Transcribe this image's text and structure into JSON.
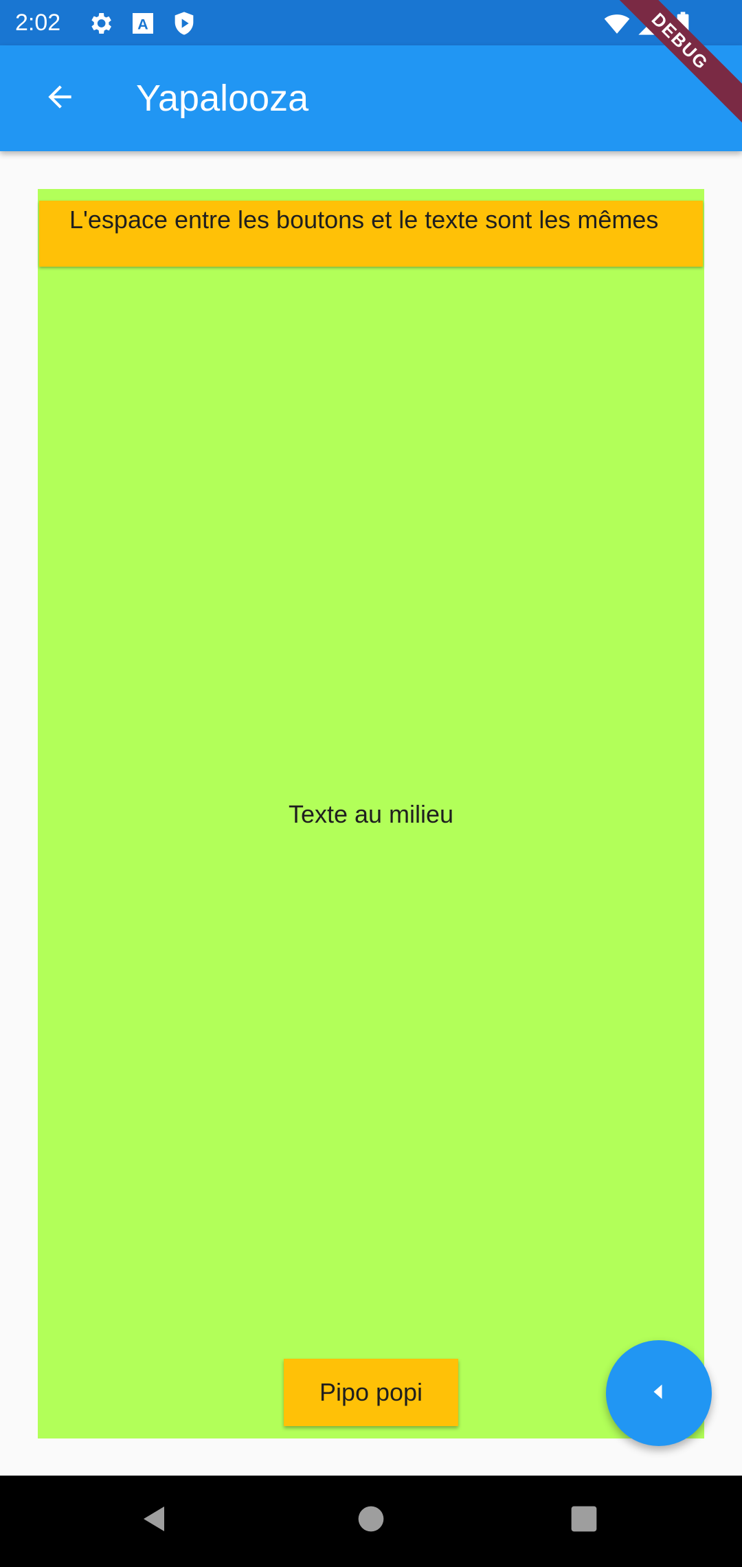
{
  "status_bar": {
    "time": "2:02",
    "icons": [
      "gear-icon",
      "font-a-icon",
      "shield-play-icon",
      "wifi-icon",
      "cellular-signal-icon",
      "battery-icon"
    ]
  },
  "app_bar": {
    "title": "Yapalooza",
    "back_icon": "arrow-back-icon",
    "debug_banner": "DEBUG"
  },
  "content": {
    "background_color": "#b2ff59",
    "top_button_label": "L'espace entre les boutons et le texte sont les mêmes",
    "middle_text": "Texte au milieu",
    "bottom_button_label": "Pipo popi",
    "button_color": "#ffc107"
  },
  "fab": {
    "icon": "caret-left-icon",
    "color": "#2196f3"
  },
  "nav_bar": {
    "icons": [
      "back-triangle-icon",
      "home-circle-icon",
      "recents-square-icon"
    ]
  }
}
